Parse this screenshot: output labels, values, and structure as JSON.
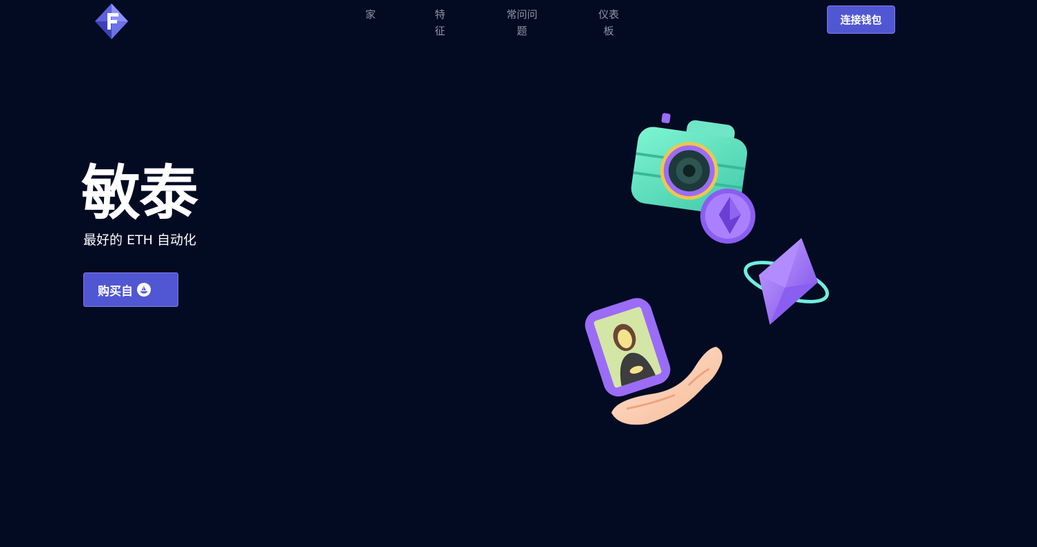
{
  "header": {
    "logo_icon": "diamond-logo-icon",
    "nav": [
      {
        "label_line1": "家",
        "label_line2": ""
      },
      {
        "label_line1": "特",
        "label_line2": "征"
      },
      {
        "label_line1": "常问问",
        "label_line2": "题"
      },
      {
        "label_line1": "仪表",
        "label_line2": "板"
      }
    ],
    "connect_label": "连接钱包"
  },
  "hero": {
    "title": "敏泰",
    "subtitle": "最好的 ETH 自动化",
    "buy_label": "购买自",
    "buy_icon": "opensea-icon"
  },
  "colors": {
    "background": "#030b23",
    "accent": "#5157d3",
    "nav_text": "#8e94a7",
    "mint": "#5fe6c0",
    "purple": "#9b6cf6"
  }
}
